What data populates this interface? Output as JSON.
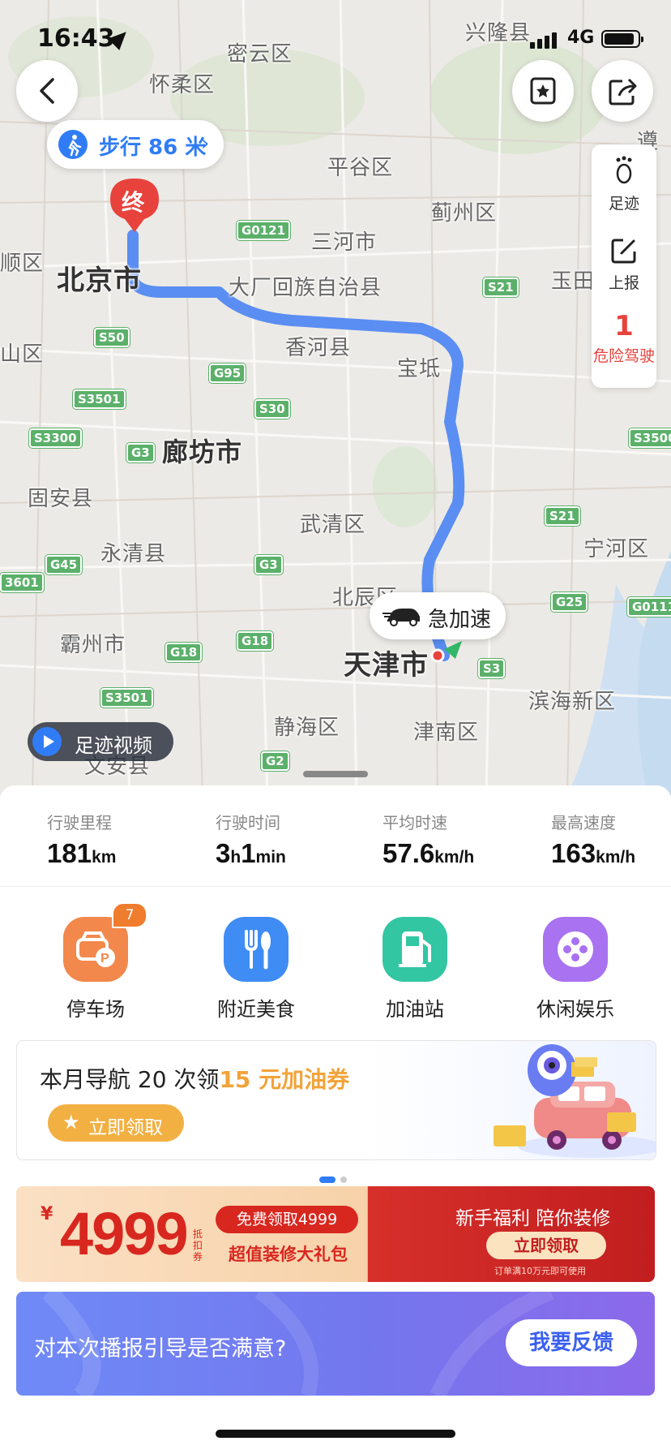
{
  "status_bar": {
    "time": "16:43",
    "network": "4G"
  },
  "map": {
    "walk_label": "步行 86 米",
    "chevron": "›",
    "end_marker_label": "终",
    "event_label": "急加速",
    "video_label": "足迹视频",
    "places": {
      "xinglong": "兴隆县",
      "miyun": "密云区",
      "huairou": "怀柔区",
      "pinggu": "平谷区",
      "jizhou": "蓟州区",
      "sanhe": "三河市",
      "beijing": "北京市",
      "dachang": "大厂回族自治县",
      "yutian": "玉田",
      "xianghe": "香河县",
      "baodi": "宝坻",
      "langfang": "廊坊市",
      "gu_an": "固安县",
      "wuqing": "武清区",
      "yongqing": "永清县",
      "ninghe": "宁河区",
      "beichen": "北辰区",
      "bazhou": "霸州市",
      "tianjin": "天津市",
      "binhai": "滨海新区",
      "jinghai": "静海区",
      "jinnan": "津南区",
      "wen_an": "文安县",
      "shunyi_partial": "顺区",
      "fangshan_partial": "山区",
      "zunhua_partial": "遵"
    },
    "roads": [
      "G0121",
      "S21",
      "S50",
      "G95",
      "S3501",
      "S30",
      "S3300",
      "G3",
      "S3500",
      "S21",
      "G45",
      "G3",
      "3601",
      "G25",
      "G0111",
      "G18",
      "G18",
      "S3501",
      "S3",
      "G2"
    ]
  },
  "side_panel": {
    "footprint_label": "足迹",
    "report_label": "上报",
    "danger_count": "1",
    "danger_label": "危险驾驶"
  },
  "trip_stats": [
    {
      "caption": "行驶里程",
      "value_parts": [
        {
          "n": "181"
        },
        {
          "u": "km"
        }
      ]
    },
    {
      "caption": "行驶时间",
      "value_parts": [
        {
          "n": "3"
        },
        {
          "u": "h"
        },
        {
          "n": "1"
        },
        {
          "u": "min"
        }
      ]
    },
    {
      "caption": "平均时速",
      "value_parts": [
        {
          "n": "57.6"
        },
        {
          "u": "km/h"
        }
      ]
    },
    {
      "caption": "最高速度",
      "value_parts": [
        {
          "n": "163"
        },
        {
          "u": "km/h"
        }
      ]
    }
  ],
  "services": [
    {
      "label": "停车场",
      "icon": "parking-car-icon",
      "color": "#f2884b",
      "badge": "7"
    },
    {
      "label": "附近美食",
      "icon": "fork-spoon-icon",
      "color": "#3f8cf4"
    },
    {
      "label": "加油站",
      "icon": "fuel-pump-icon",
      "color": "#33c6a3"
    },
    {
      "label": "休闲娱乐",
      "icon": "film-reel-icon",
      "color": "#a872f0"
    }
  ],
  "promo": {
    "title_prefix": "本月导航 20 次领",
    "title_highlight": "15 元加油券",
    "button": "立即领取",
    "accent": "#f2b043"
  },
  "ad": {
    "yen": "¥",
    "amount": "4999",
    "small": "抵扣券",
    "pill": "免费领取4999",
    "subtitle": "超值装修大礼包",
    "right_title": "新手福利  陪你装修",
    "right_button": "立即领取",
    "note": "订单满10万元即可使用"
  },
  "feedback": {
    "question": "对本次播报引导是否满意?",
    "button": "我要反馈"
  },
  "colors": {
    "route": "#5b8ef2",
    "brand_blue": "#2f7cf6",
    "danger_red": "#e8423c"
  }
}
